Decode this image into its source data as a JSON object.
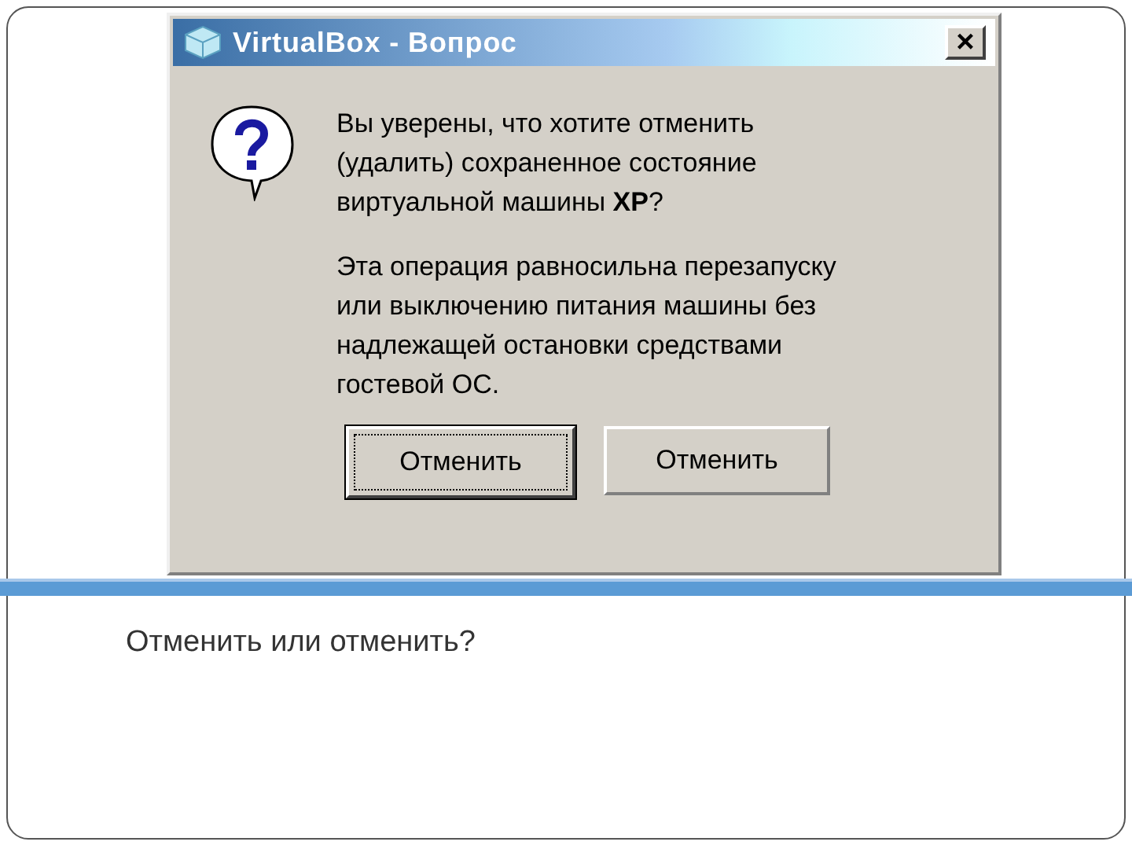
{
  "dialog": {
    "title": "VirtualBox - Вопрос",
    "close": "×",
    "message": "Вы уверены, что хотите отменить (удалить) сохраненное состояние виртуальной машины **XP**?",
    "details": "Эта операция равносильна перезапуску или выключению питания машины без надлежащей остановки средствами гостевой ОС.",
    "buttons": [
      {
        "label": "Отменить",
        "focused": true
      },
      {
        "label": "Отменить",
        "focused": false
      }
    ]
  },
  "caption": "Отменить или отменить?"
}
